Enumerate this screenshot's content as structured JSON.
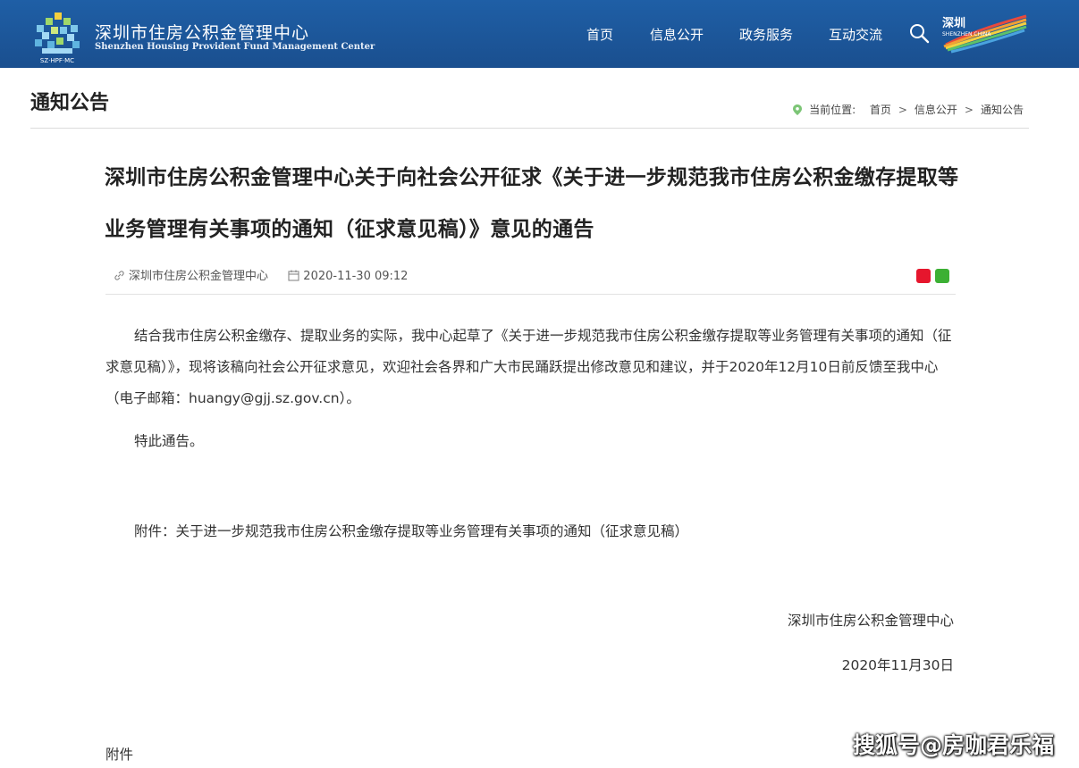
{
  "header": {
    "logo_cn": "深圳市住房公积金管理中心",
    "logo_en": "Shenzhen Housing Provident Fund Management Center",
    "logo_abbr": "SZ·HPF·MC",
    "nav": [
      {
        "label": "首页"
      },
      {
        "label": "信息公开"
      },
      {
        "label": "政务服务"
      },
      {
        "label": "互动交流"
      }
    ],
    "city_logo_text": "深圳",
    "city_logo_en": "SHENZHEN CHINA"
  },
  "page": {
    "title": "通知公告",
    "breadcrumb": {
      "prefix": "当前位置:",
      "items": [
        "首页",
        "信息公开",
        "通知公告"
      ]
    }
  },
  "article": {
    "title": "深圳市住房公积金管理中心关于向社会公开征求《关于进一步规范我市住房公积金缴存提取等业务管理有关事项的通知（征求意见稿）》意见的通告",
    "source": "深圳市住房公积金管理中心",
    "date": "2020-11-30 09:12",
    "paragraph1": "结合我市住房公积金缴存、提取业务的实际，我中心起草了《关于进一步规范我市住房公积金缴存提取等业务管理有关事项的通知（征求意见稿）》，现将该稿向社会公开征求意见，欢迎社会各界和广大市民踊跃提出修改意见和建议，并于2020年12月10日前反馈至我中心（电子邮箱：huangy@gjj.sz.gov.cn）。",
    "paragraph2": "特此通告。",
    "attachment_line": "附件：关于进一步规范我市住房公积金缴存提取等业务管理有关事项的通知（征求意见稿）",
    "sign_org": "深圳市住房公积金管理中心",
    "sign_date": "2020年11月30日",
    "attach_label": "附件"
  },
  "watermark": "搜狐号@房咖君乐福",
  "colors": {
    "header_bg": "#1f5fa6",
    "weibo": "#e6162d",
    "wechat": "#3cb034"
  }
}
